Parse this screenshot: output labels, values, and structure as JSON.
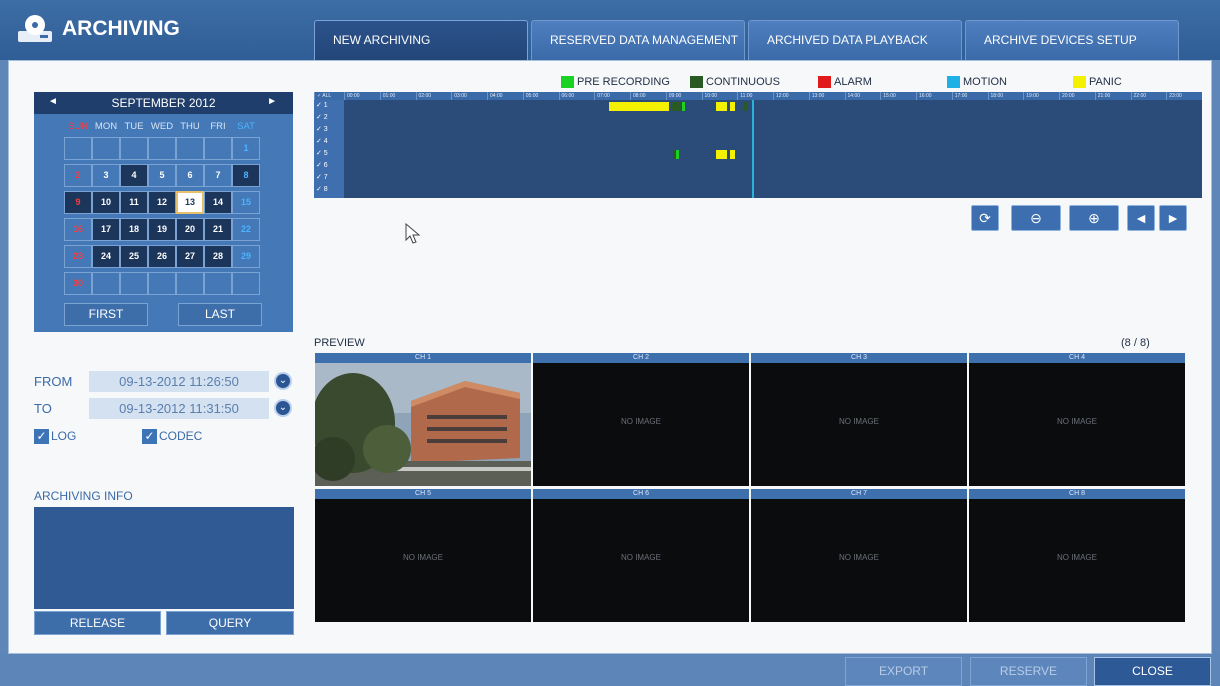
{
  "app": {
    "title": "ARCHIVING",
    "icon": "disc-drive-icon"
  },
  "tabs": [
    {
      "label": "NEW ARCHIVING",
      "active": true
    },
    {
      "label": "RESERVED DATA MANAGEMENT",
      "active": false
    },
    {
      "label": "ARCHIVED DATA PLAYBACK",
      "active": false
    },
    {
      "label": "ARCHIVE DEVICES SETUP",
      "active": false
    }
  ],
  "calendar": {
    "prev": "◄",
    "next": "►",
    "month": "SEPTEMBER 2012",
    "days_of_week": [
      "SUN",
      "MON",
      "TUE",
      "WED",
      "THU",
      "FRI",
      "SAT"
    ],
    "weeks": [
      [
        "",
        "",
        "",
        "",
        "",
        "",
        "1"
      ],
      [
        "2",
        "3",
        "4",
        "5",
        "6",
        "7",
        "8"
      ],
      [
        "9",
        "10",
        "11",
        "12",
        "13",
        "14",
        "15"
      ],
      [
        "16",
        "17",
        "18",
        "19",
        "20",
        "21",
        "22"
      ],
      [
        "23",
        "24",
        "25",
        "26",
        "27",
        "28",
        "29"
      ],
      [
        "30",
        "",
        "",
        "",
        "",
        "",
        ""
      ]
    ],
    "days_with_data": [
      "4",
      "8",
      "9",
      "10",
      "11",
      "12",
      "13",
      "14",
      "17",
      "18",
      "19",
      "20",
      "21",
      "24",
      "25",
      "26",
      "27",
      "28"
    ],
    "selected_day": "13",
    "first_label": "FIRST",
    "last_label": "LAST"
  },
  "legend": [
    {
      "label": "PRE RECORDING",
      "color": "#19d224"
    },
    {
      "label": "CONTINUOUS",
      "color": "#2a5a24"
    },
    {
      "label": "ALARM",
      "color": "#e11b1b"
    },
    {
      "label": "MOTION",
      "color": "#1fb0e6"
    },
    {
      "label": "PANIC",
      "color": "#f3f000"
    }
  ],
  "timeline": {
    "all_label": "ALL",
    "hours": [
      "00:00",
      "01:00",
      "02:00",
      "03:00",
      "04:00",
      "05:00",
      "06:00",
      "07:00",
      "08:00",
      "09:00",
      "10:00",
      "11:00",
      "12:00",
      "13:00",
      "14:00",
      "15:00",
      "16:00",
      "17:00",
      "18:00",
      "19:00",
      "20:00",
      "21:00",
      "22:00",
      "23:00"
    ],
    "channels": [
      "1",
      "2",
      "3",
      "4",
      "5",
      "6",
      "7",
      "8"
    ],
    "cursor_time": "11:26:50",
    "controls": [
      {
        "name": "refresh-icon",
        "label": "⟳"
      },
      {
        "name": "zoom-out-icon",
        "label": "⊖"
      },
      {
        "name": "zoom-in-icon",
        "label": "⊕"
      },
      {
        "name": "prev-icon",
        "label": "◄"
      },
      {
        "name": "next-icon",
        "label": "►"
      }
    ]
  },
  "form": {
    "from_label": "FROM",
    "from_value": "09-13-2012 11:26:50",
    "to_label": "TO",
    "to_value": "09-13-2012 11:31:50",
    "log_label": "LOG",
    "codec_label": "CODEC",
    "log_checked": true,
    "codec_checked": true,
    "info_label": "ARCHIVING INFO",
    "release_label": "RELEASE",
    "query_label": "QUERY"
  },
  "preview": {
    "label": "PREVIEW",
    "count": "(8 / 8)",
    "channels": [
      {
        "title": "CH 1",
        "text": ""
      },
      {
        "title": "CH 2",
        "text": "NO IMAGE"
      },
      {
        "title": "CH 3",
        "text": "NO IMAGE"
      },
      {
        "title": "CH 4",
        "text": "NO IMAGE"
      },
      {
        "title": "CH 5",
        "text": "NO IMAGE"
      },
      {
        "title": "CH 6",
        "text": "NO IMAGE"
      },
      {
        "title": "CH 7",
        "text": "NO IMAGE"
      },
      {
        "title": "CH 8",
        "text": "NO IMAGE"
      }
    ]
  },
  "footer": {
    "export_label": "EXPORT",
    "reserve_label": "RESERVE",
    "close_label": "CLOSE"
  }
}
